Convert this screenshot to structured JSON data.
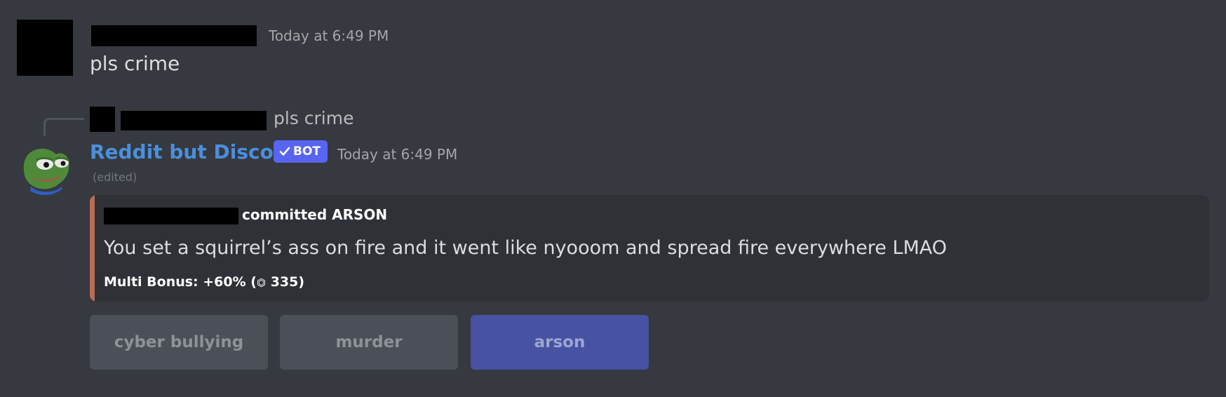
{
  "message1": {
    "timestamp": "Today at 6:49 PM",
    "content": "pls crime"
  },
  "reply": {
    "content": "pls crime"
  },
  "bot_message": {
    "author": "Reddit but Discord",
    "badge": "BOT",
    "badge_icon": "checkmark-icon",
    "timestamp": "Today at 6:49 PM",
    "edited": "(edited)",
    "avatar_icon": "pepe-frog-icon",
    "embed": {
      "accent_color": "#b96d56",
      "author": "committed ARSON",
      "description": "You set a squirrel’s ass on fire and it went like nyooom and spread fire everywhere LMAO",
      "footer_prefix": "Multi Bonus: +60% (",
      "footer_coin_icon": "coin-icon",
      "footer_coin": "⏣",
      "footer_suffix": " 335)"
    },
    "buttons": [
      {
        "label": "cyber bullying"
      },
      {
        "label": "murder"
      },
      {
        "label": "arson",
        "selected": true
      }
    ]
  },
  "colors": {
    "background": "#36393f",
    "bot_name": "#4a8fdd",
    "bot_badge": "#5865f2",
    "selected_button": "#4752a3"
  }
}
